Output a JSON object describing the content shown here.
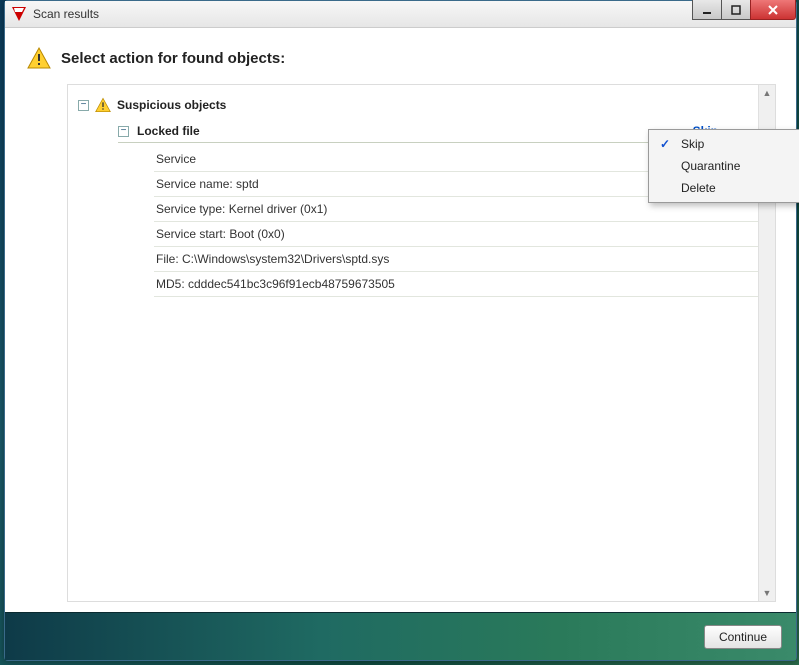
{
  "window": {
    "title": "Scan results"
  },
  "header": {
    "text": "Select action for found objects:"
  },
  "tree": {
    "group_label": "Suspicious objects",
    "sub_label": "Locked file",
    "action_label": "Skip",
    "details": [
      "Service",
      "Service name: sptd",
      "Service type: Kernel driver (0x1)",
      "Service start: Boot (0x0)",
      "File: C:\\Windows\\system32\\Drivers\\sptd.sys",
      "MD5: cdddec541bc3c96f91ecb48759673505"
    ]
  },
  "menu": {
    "items": [
      "Skip",
      "Quarantine",
      "Delete"
    ],
    "selected": "Skip"
  },
  "footer": {
    "continue": "Continue"
  }
}
